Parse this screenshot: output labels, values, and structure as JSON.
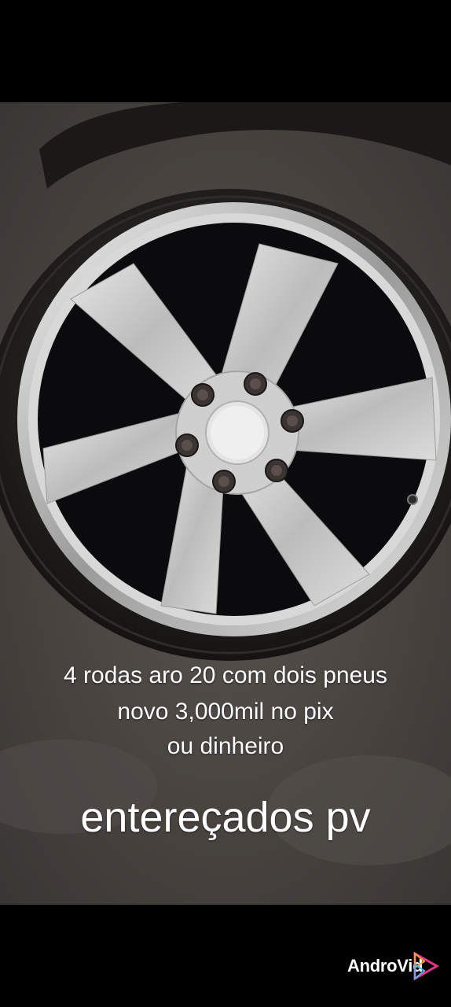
{
  "caption": {
    "line1": "4 rodas aro 20 com dois pneus",
    "line2": "novo 3,000mil no pix",
    "line3": "ou  dinheiro",
    "headline": "entereçados pv"
  },
  "watermark": {
    "prefix": "Andro",
    "suffix": "Vid"
  },
  "colors": {
    "background": "#000000",
    "ground": "#4a4643",
    "tire": "#1e1d1c",
    "spoke": "#cfcfcf",
    "gap": "#0a0a0c",
    "text": "#ffffff",
    "logo_accent": "#e8358a"
  }
}
